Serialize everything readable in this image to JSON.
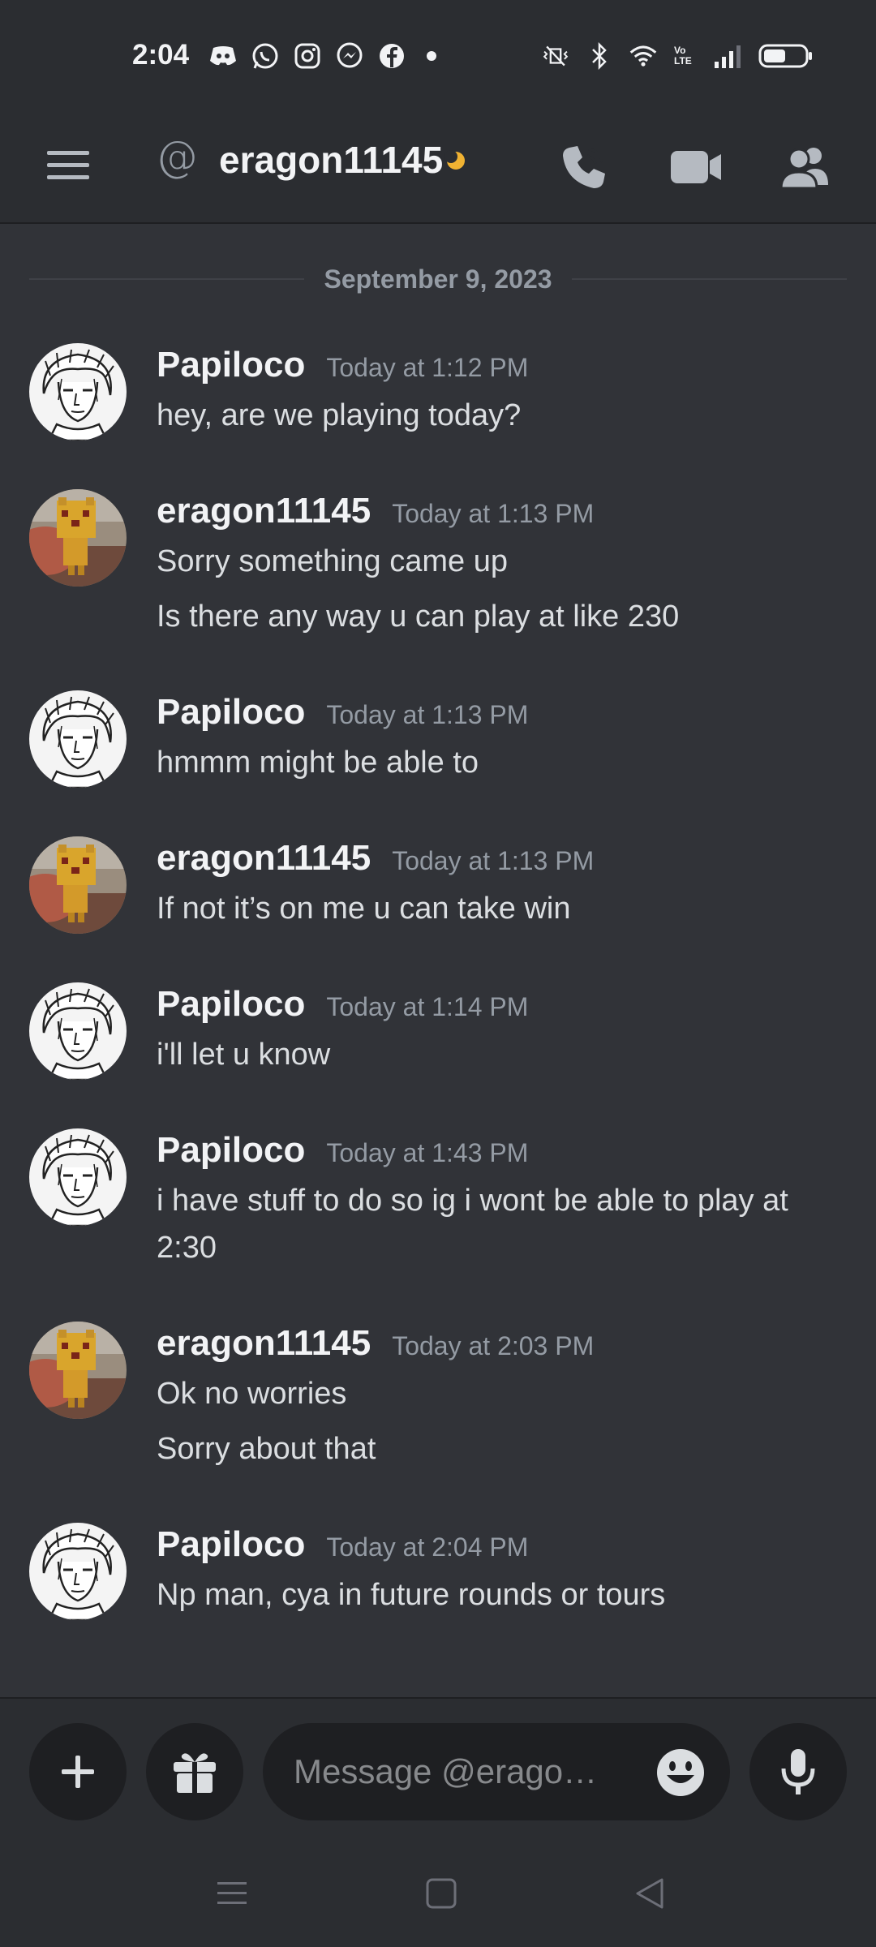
{
  "status_bar": {
    "time": "2:04",
    "left_icons": [
      "discord-notification-icon",
      "whatsapp-icon",
      "instagram-icon",
      "messenger-icon",
      "facebook-icon"
    ],
    "right_icons": [
      "mute-vibrate-icon",
      "bluetooth-icon",
      "wifi-icon",
      "volte-icon",
      "signal-icon",
      "battery-icon"
    ],
    "volte_label": "Vo LTE"
  },
  "header": {
    "at_symbol": "@",
    "title": "eragon11145",
    "status": "idle",
    "status_color": "#f0b232",
    "buttons": [
      "call-icon",
      "video-icon",
      "members-icon"
    ]
  },
  "date_divider": "September 9, 2023",
  "messages": [
    {
      "author": "Papiloco",
      "timestamp": "Today at 1:12 PM",
      "avatar": "papiloco",
      "lines": [
        "hey, are we playing today?"
      ]
    },
    {
      "author": "eragon11145",
      "timestamp": "Today at 1:13 PM",
      "avatar": "eragon",
      "lines": [
        "Sorry something came up",
        "Is there any way u can play at like 230"
      ]
    },
    {
      "author": "Papiloco",
      "timestamp": "Today at 1:13 PM",
      "avatar": "papiloco",
      "lines": [
        "hmmm might be able to"
      ]
    },
    {
      "author": "eragon11145",
      "timestamp": "Today at 1:13 PM",
      "avatar": "eragon",
      "lines": [
        "If not it’s on me u can take win"
      ]
    },
    {
      "author": "Papiloco",
      "timestamp": "Today at 1:14 PM",
      "avatar": "papiloco",
      "lines": [
        "i'll let u know"
      ]
    },
    {
      "author": "Papiloco",
      "timestamp": "Today at 1:43 PM",
      "avatar": "papiloco",
      "lines": [
        "i have stuff to do so ig i wont be able to play at",
        "2:30"
      ]
    },
    {
      "author": "eragon11145",
      "timestamp": "Today at 2:03 PM",
      "avatar": "eragon",
      "lines": [
        "Ok no worries",
        "Sorry about that"
      ]
    },
    {
      "author": "Papiloco",
      "timestamp": "Today at 2:04 PM",
      "avatar": "papiloco",
      "lines": [
        "Np man, cya in future rounds or tours"
      ]
    }
  ],
  "composer": {
    "placeholder": "Message @erago…",
    "value": ""
  },
  "colors": {
    "background": "#313338",
    "header": "#2b2d31",
    "input": "#1e1f22",
    "text": "#dbdee1",
    "muted": "#949ba4"
  }
}
